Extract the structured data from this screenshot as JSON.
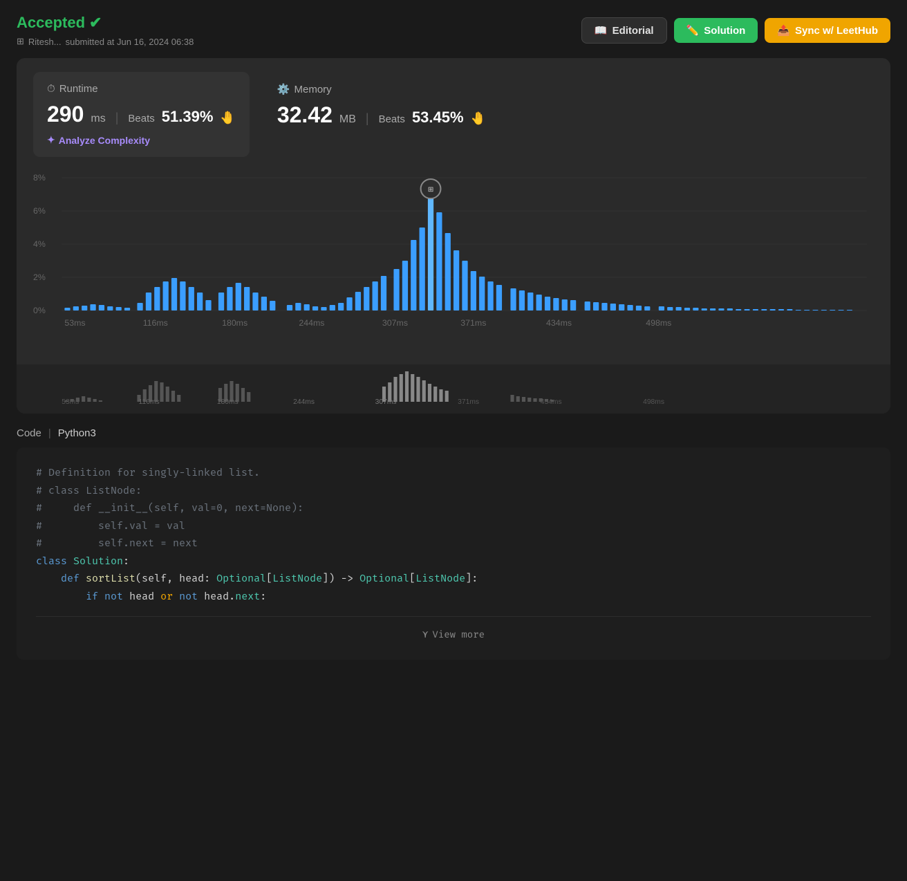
{
  "header": {
    "accepted_label": "Accepted",
    "check": "✓",
    "submitted_by": "Ritesh...",
    "submitted_at": "submitted at Jun 16, 2024 06:38",
    "editorial_btn": "Editorial",
    "solution_btn": "Solution",
    "leethub_btn": "Sync w/ LeetHub"
  },
  "runtime": {
    "label": "Runtime",
    "value": "290",
    "unit": "ms",
    "beats_label": "Beats",
    "beats_pct": "51.39%",
    "wave": "👋",
    "analyze_label": "Analyze Complexity"
  },
  "memory": {
    "label": "Memory",
    "value": "32.42",
    "unit": "MB",
    "beats_label": "Beats",
    "beats_pct": "53.45%",
    "wave": "👋"
  },
  "chart": {
    "y_labels": [
      "0%",
      "2%",
      "4%",
      "6%",
      "8%"
    ],
    "x_labels": [
      "53ms",
      "116ms",
      "180ms",
      "244ms",
      "307ms",
      "371ms",
      "434ms",
      "498ms"
    ]
  },
  "code": {
    "section_label": "Code",
    "lang": "Python3",
    "lines": [
      "# Definition for singly-linked list.",
      "# class ListNode:",
      "#     def __init__(self, val=0, next=None):",
      "#         self.val = val",
      "#         self.next = next",
      "class Solution:",
      "    def sortList(self, head: Optional[ListNode]) -> Optional[ListNode]:",
      "        if not head or not head.next:"
    ],
    "view_more": "View more"
  }
}
